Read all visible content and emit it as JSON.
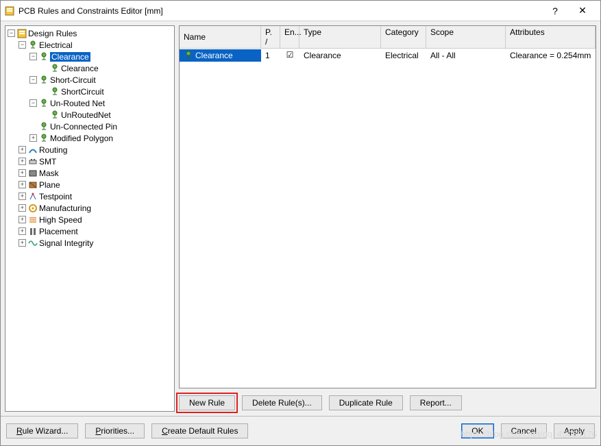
{
  "window": {
    "title": "PCB Rules and Constraints Editor [mm]"
  },
  "tree": [
    {
      "id": "design-rules",
      "label": "Design Rules",
      "depth": 0,
      "toggle": "-",
      "icon": "rules"
    },
    {
      "id": "electrical",
      "label": "Electrical",
      "depth": 1,
      "toggle": "-",
      "icon": "elec"
    },
    {
      "id": "clearance-cat",
      "label": "Clearance",
      "depth": 2,
      "toggle": "-",
      "icon": "elec",
      "selected": true
    },
    {
      "id": "clearance-rule",
      "label": "Clearance",
      "depth": 3,
      "toggle": " ",
      "icon": "elec"
    },
    {
      "id": "short-circuit",
      "label": "Short-Circuit",
      "depth": 2,
      "toggle": "-",
      "icon": "elec"
    },
    {
      "id": "shortcircuit-rule",
      "label": "ShortCircuit",
      "depth": 3,
      "toggle": " ",
      "icon": "elec"
    },
    {
      "id": "unrouted-net",
      "label": "Un-Routed Net",
      "depth": 2,
      "toggle": "-",
      "icon": "elec"
    },
    {
      "id": "unroutednet-rule",
      "label": "UnRoutedNet",
      "depth": 3,
      "toggle": " ",
      "icon": "elec"
    },
    {
      "id": "unconnected-pin",
      "label": "Un-Connected Pin",
      "depth": 2,
      "toggle": " ",
      "icon": "elec"
    },
    {
      "id": "modified-polygon",
      "label": "Modified Polygon",
      "depth": 2,
      "toggle": "+",
      "icon": "elec"
    },
    {
      "id": "routing",
      "label": "Routing",
      "depth": 1,
      "toggle": "+",
      "icon": "route"
    },
    {
      "id": "smt",
      "label": "SMT",
      "depth": 1,
      "toggle": "+",
      "icon": "smt"
    },
    {
      "id": "mask",
      "label": "Mask",
      "depth": 1,
      "toggle": "+",
      "icon": "mask"
    },
    {
      "id": "plane",
      "label": "Plane",
      "depth": 1,
      "toggle": "+",
      "icon": "plane"
    },
    {
      "id": "testpoint",
      "label": "Testpoint",
      "depth": 1,
      "toggle": "+",
      "icon": "test"
    },
    {
      "id": "manufacturing",
      "label": "Manufacturing",
      "depth": 1,
      "toggle": "+",
      "icon": "manuf"
    },
    {
      "id": "high-speed",
      "label": "High Speed",
      "depth": 1,
      "toggle": "+",
      "icon": "hspeed"
    },
    {
      "id": "placement",
      "label": "Placement",
      "depth": 1,
      "toggle": "+",
      "icon": "place"
    },
    {
      "id": "signal-integrity",
      "label": "Signal Integrity",
      "depth": 1,
      "toggle": "+",
      "icon": "sigint"
    }
  ],
  "grid": {
    "headers": {
      "name": "Name",
      "p": "P. /",
      "en": "En...",
      "type": "Type",
      "cat": "Category",
      "scope": "Scope",
      "attr": "Attributes"
    },
    "rows": [
      {
        "name": "Clearance",
        "p": "1",
        "en": true,
        "type": "Clearance",
        "cat": "Electrical",
        "scope": "All   -   All",
        "attr": "Clearance = 0.254mm",
        "selected": true
      }
    ]
  },
  "ruleButtons": {
    "new": "New Rule",
    "delete": "Delete Rule(s)...",
    "duplicate": "Duplicate Rule",
    "report": "Report..."
  },
  "footer": {
    "wizard_pre": "R",
    "wizard_post": "ule Wizard...",
    "priorities_pre": "P",
    "priorities_post": "riorities...",
    "create_pre": "C",
    "create_post": "reate Default Rules",
    "ok": "OK",
    "cancel": "Cancel",
    "apply": "Apply"
  },
  "watermark": "https://blog.csdn.net/qq_45080176"
}
